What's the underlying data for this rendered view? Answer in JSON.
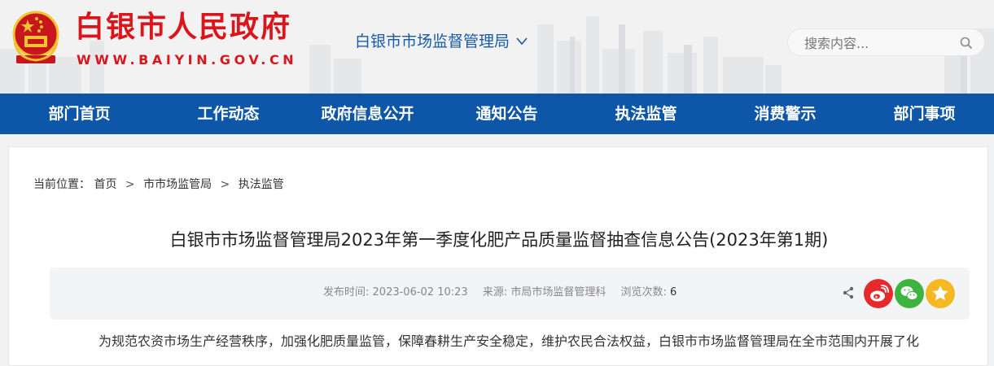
{
  "header": {
    "site_title": "白银市人民政府",
    "site_url": "WWW.BAIYIN.GOV.CN",
    "department": "白银市市场监督管理局",
    "search_placeholder": "搜索内容..."
  },
  "nav": [
    "部门首页",
    "工作动态",
    "政府信息公开",
    "通知公告",
    "执法监管",
    "消费警示",
    "部门事项"
  ],
  "breadcrumb": {
    "prefix": "当前位置：",
    "items": [
      "首页",
      "市市场监管局",
      "执法监管"
    ],
    "separator": ">"
  },
  "article": {
    "title": "白银市市场监督管理局2023年第一季度化肥产品质量监督抽查信息公告(2023年第1期)",
    "publish_label": "发布时间:",
    "publish_time": "2023-06-02 10:23",
    "source_label": "来源:",
    "source": "市局市场监督管理科",
    "views_label": "浏览次数:",
    "views": "6",
    "body_first_line": "为规范农资市场生产经营秩序，加强化肥质量监管，保障春耕生产安全稳定，维护农民合法权益，白银市市场监督管理局在全市范围内开展了化"
  },
  "colors": {
    "brand_red": "#d9161c",
    "nav_blue": "#0d56a8",
    "weibo": "#e6292c",
    "wechat": "#3fb33f",
    "favorite": "#f5b823"
  },
  "icons": [
    "national-emblem",
    "chevron-down-icon",
    "search-icon",
    "share-icon",
    "weibo-icon",
    "wechat-icon",
    "star-icon"
  ]
}
